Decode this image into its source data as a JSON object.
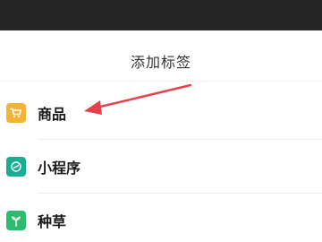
{
  "dialog": {
    "title": "添加标签"
  },
  "menu": {
    "items": [
      {
        "label": "商品",
        "icon": "shopping-cart-icon",
        "color": "#f5b335"
      },
      {
        "label": "小程序",
        "icon": "mini-program-icon",
        "color": "#1aad92"
      },
      {
        "label": "种草",
        "icon": "sprout-icon",
        "color": "#2dbc6e"
      }
    ]
  },
  "colors": {
    "status_bar": "#262626",
    "annotation_arrow": "#e8404a"
  }
}
